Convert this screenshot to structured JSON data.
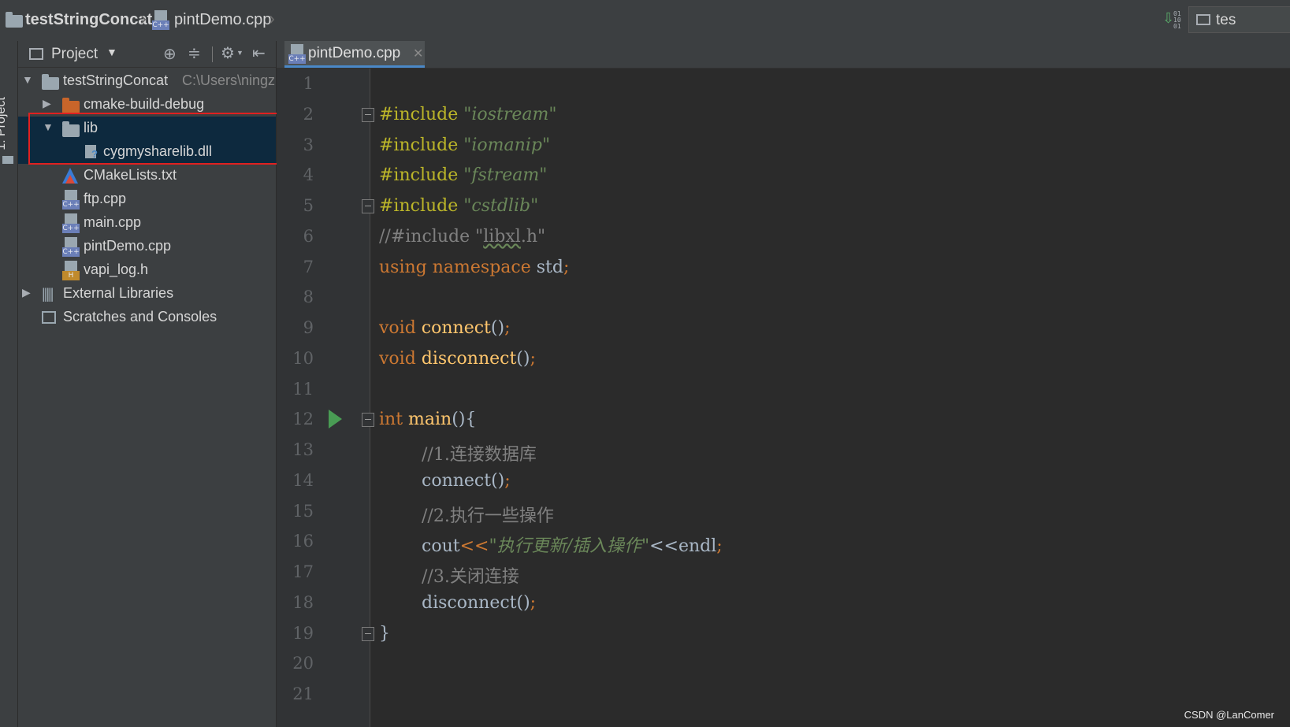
{
  "breadcrumb": {
    "project": "testStringConcat",
    "file": "pintDemo.cpp"
  },
  "topbar_right": {
    "run_config": "tes"
  },
  "tool_stripe": {
    "project_label": "1: Project"
  },
  "project_panel": {
    "view_name": "Project",
    "tree": [
      {
        "label": "testStringConcat",
        "path": "C:\\Users\\ningz",
        "type": "folder",
        "expanded": true
      },
      {
        "label": "cmake-build-debug",
        "type": "folder-excluded",
        "expanded": false
      },
      {
        "label": "lib",
        "type": "folder",
        "expanded": true,
        "selected": true
      },
      {
        "label": "cygmysharelib.dll",
        "type": "unknown-file"
      },
      {
        "label": "CMakeLists.txt",
        "type": "cmake-file"
      },
      {
        "label": "ftp.cpp",
        "type": "cpp-file"
      },
      {
        "label": "main.cpp",
        "type": "cpp-file"
      },
      {
        "label": "pintDemo.cpp",
        "type": "cpp-file"
      },
      {
        "label": "vapi_log.h",
        "type": "header-file"
      },
      {
        "label": "External Libraries",
        "type": "library",
        "expanded": false
      },
      {
        "label": "Scratches and Consoles",
        "type": "scratches"
      }
    ]
  },
  "editor": {
    "tab_label": "pintDemo.cpp",
    "line_numbers": [
      "1",
      "2",
      "3",
      "4",
      "5",
      "6",
      "7",
      "8",
      "9",
      "10",
      "11",
      "12",
      "13",
      "14",
      "15",
      "16",
      "17",
      "18",
      "19",
      "20",
      "21"
    ],
    "lines": [
      "",
      "#include \"iostream\"",
      "#include \"iomanip\"",
      "#include \"fstream\"",
      "#include \"cstdlib\"",
      "//#include \"libxl.h\"",
      "using namespace std;",
      "",
      "void connect();",
      "void disconnect();",
      "",
      "int main(){",
      "    //1.连接数据库",
      "    connect();",
      "    //2.执行一些操作",
      "    cout<<\"执行更新/插入操作\"<<endl;",
      "    //3.关闭连接",
      "    disconnect();",
      "}",
      "",
      ""
    ],
    "tokens": {
      "l2": {
        "pp": "#include",
        "str": "\"iostream\""
      },
      "l3": {
        "pp": "#include",
        "str": "\"iomanip\""
      },
      "l4": {
        "pp": "#include",
        "str": "\"fstream\""
      },
      "l5": {
        "pp": "#include",
        "str": "\"cstdlib\""
      },
      "l6": {
        "cm_a": "//#include \"",
        "cm_u": "libxl",
        "cm_b": ".h\""
      },
      "l7": {
        "kw1": "using",
        "kw2": "namespace",
        "id": "std",
        "semi": ";"
      },
      "l9": {
        "kw": "void",
        "fn": "connect",
        "paren": "()",
        "semi": ";"
      },
      "l10": {
        "kw": "void",
        "fn": "disconnect",
        "paren": "()",
        "semi": ";"
      },
      "l12": {
        "kw": "int",
        "fn": "main",
        "rest": "(){"
      },
      "l13": {
        "cm": "//1.连接数据库"
      },
      "l14": {
        "id": "connect",
        "paren": "()",
        "semi": ";"
      },
      "l15": {
        "cm": "//2.执行一些操作"
      },
      "l16": {
        "id": "cout",
        "op1": "<<",
        "str": "\"执行更新/插入操作\"",
        "op2": "<<",
        "id2": "endl",
        "semi": ";"
      },
      "l17": {
        "cm": "//3.关闭连接"
      },
      "l18": {
        "id": "disconnect",
        "paren": "()",
        "semi": ";"
      },
      "l19": {
        "brace": "}"
      }
    }
  },
  "watermark": "CSDN @LanComer",
  "colors": {
    "editor_bg": "#2b2b2b",
    "panel_bg": "#3c3f41",
    "keyword": "#cc7832",
    "preprocessor": "#bbb529",
    "string": "#6a8759",
    "comment": "#808080",
    "function": "#ffc66d",
    "selection": "#0d293e",
    "highlight_box": "#e02020"
  }
}
